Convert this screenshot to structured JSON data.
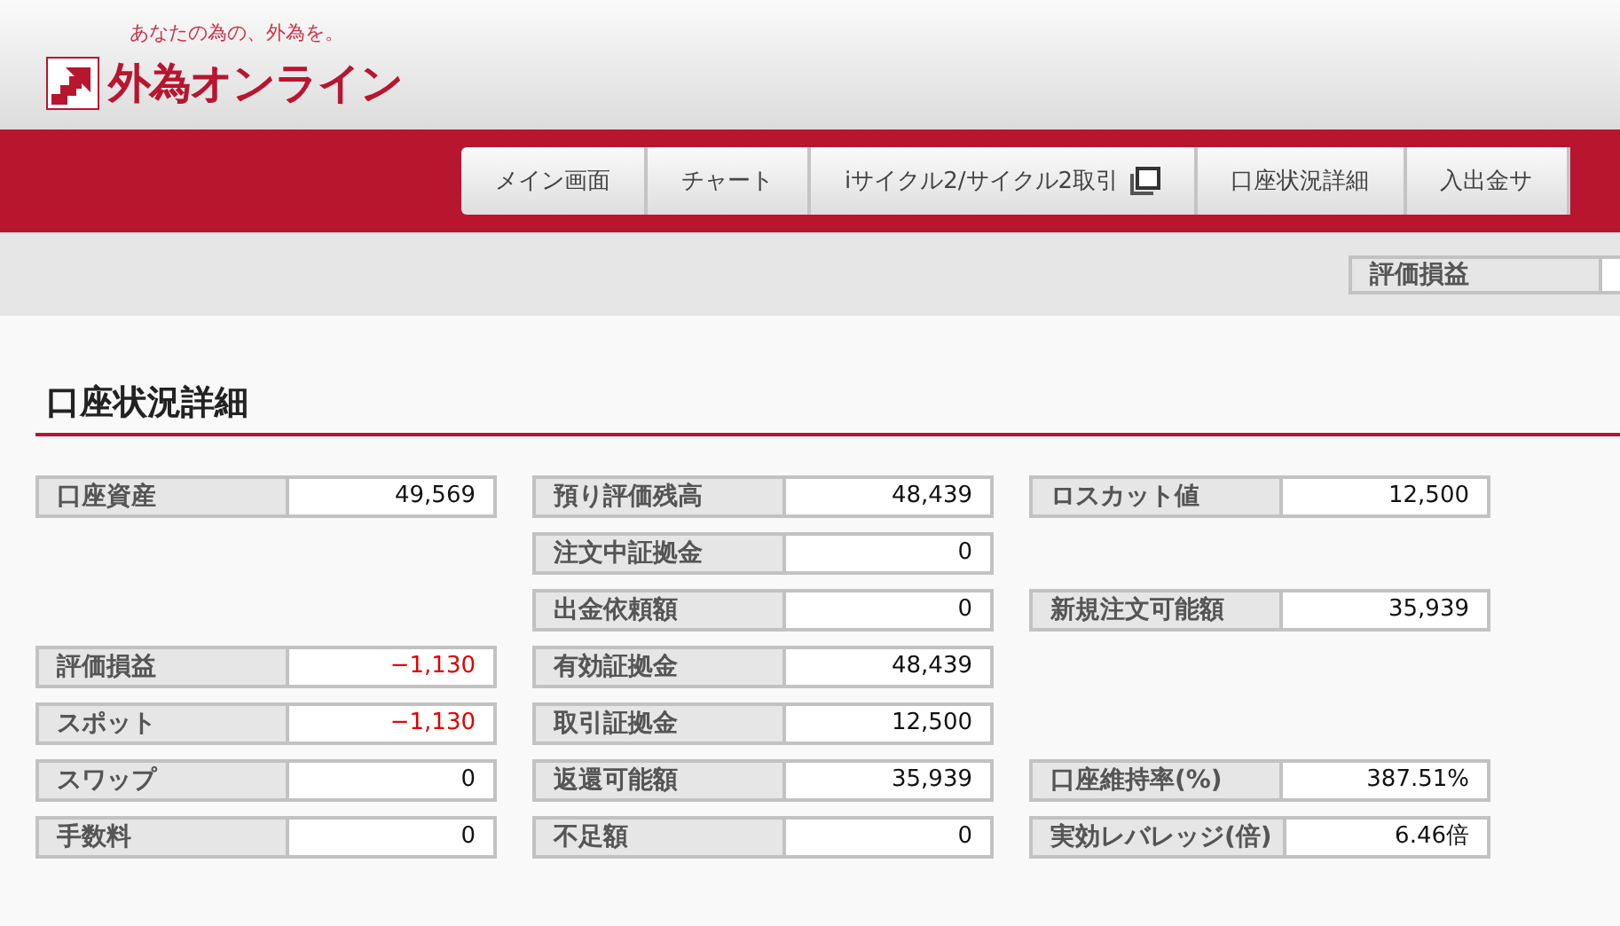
{
  "header": {
    "tagline": "あなたの為の、外為を。",
    "logo_text": "外為オンライン"
  },
  "nav": [
    {
      "label": "メイン画面",
      "external": false
    },
    {
      "label": "チャート",
      "external": false
    },
    {
      "label": "iサイクル2/サイクル2取引",
      "external": true
    },
    {
      "label": "口座状況詳細",
      "external": false
    },
    {
      "label": "入出金サ",
      "external": false
    }
  ],
  "summary_bar": {
    "label": "評価損益"
  },
  "page_title": "口座状況詳細",
  "rows": [
    [
      {
        "kind": "field",
        "label": "口座資産",
        "value": "49,569",
        "negative": false
      },
      {
        "kind": "field",
        "label": "預り評価残高",
        "value": "48,439",
        "negative": false
      },
      {
        "kind": "field",
        "label": "ロスカット値",
        "value": "12,500",
        "negative": false
      }
    ],
    [
      {
        "kind": "blank"
      },
      {
        "kind": "field",
        "label": "注文中証拠金",
        "value": "0",
        "negative": false
      },
      {
        "kind": "blank"
      }
    ],
    [
      {
        "kind": "blank"
      },
      {
        "kind": "field",
        "label": "出金依頼額",
        "value": "0",
        "negative": false
      },
      {
        "kind": "field",
        "label": "新規注文可能額",
        "value": "35,939",
        "negative": false
      }
    ],
    [
      {
        "kind": "field",
        "label": "評価損益",
        "value": "−1,130",
        "negative": true
      },
      {
        "kind": "field",
        "label": "有効証拠金",
        "value": "48,439",
        "negative": false
      },
      {
        "kind": "blank"
      }
    ],
    [
      {
        "kind": "field",
        "label": "スポット",
        "value": "−1,130",
        "negative": true
      },
      {
        "kind": "field",
        "label": "取引証拠金",
        "value": "12,500",
        "negative": false
      },
      {
        "kind": "blank"
      }
    ],
    [
      {
        "kind": "field",
        "label": "スワップ",
        "value": "0",
        "negative": false
      },
      {
        "kind": "field",
        "label": "返還可能額",
        "value": "35,939",
        "negative": false
      },
      {
        "kind": "field",
        "label": "口座維持率(%)",
        "value": "387.51%",
        "negative": false
      }
    ],
    [
      {
        "kind": "field",
        "label": "手数料",
        "value": "0",
        "negative": false
      },
      {
        "kind": "field",
        "label": "不足額",
        "value": "0",
        "negative": false
      },
      {
        "kind": "field",
        "label": "実効レバレッジ(倍)",
        "value": "6.46倍",
        "negative": false
      }
    ]
  ]
}
